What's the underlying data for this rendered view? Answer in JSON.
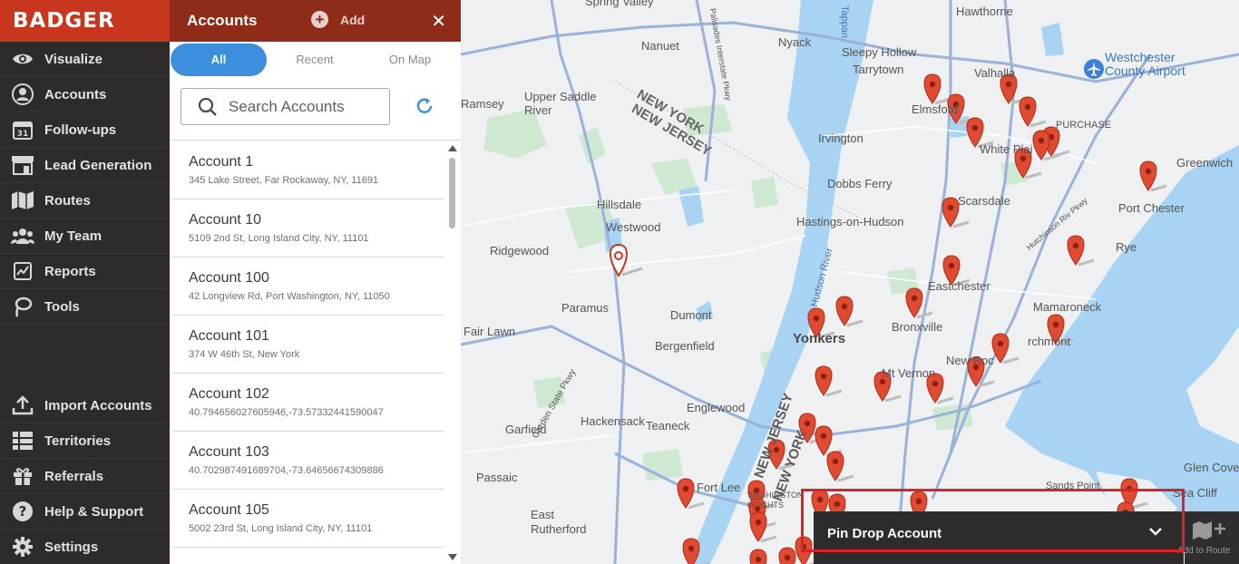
{
  "brand": {
    "logo_text": "BADGER",
    "color": "#c8361d"
  },
  "sidebar": {
    "items": [
      {
        "label": "Visualize",
        "icon": "eye-icon"
      },
      {
        "label": "Accounts",
        "icon": "user-circle-icon"
      },
      {
        "label": "Follow-ups",
        "icon": "calendar-icon",
        "icon_text": "31"
      },
      {
        "label": "Lead Generation",
        "icon": "storefront-icon"
      },
      {
        "label": "Routes",
        "icon": "map-icon"
      },
      {
        "label": "My Team",
        "icon": "team-icon"
      },
      {
        "label": "Reports",
        "icon": "report-icon"
      },
      {
        "label": "Tools",
        "icon": "lasso-icon"
      }
    ],
    "bottom_items": [
      {
        "label": "Import Accounts",
        "icon": "upload-icon"
      },
      {
        "label": "Territories",
        "icon": "territories-icon"
      },
      {
        "label": "Referrals",
        "icon": "gift-icon"
      },
      {
        "label": "Help & Support",
        "icon": "question-icon"
      },
      {
        "label": "Settings",
        "icon": "gear-icon"
      }
    ]
  },
  "panel": {
    "title": "Accounts",
    "add_label": "Add",
    "header_color": "#8e2b19",
    "tabs": [
      {
        "label": "All",
        "active": true
      },
      {
        "label": "Recent",
        "active": false
      },
      {
        "label": "On Map",
        "active": false
      }
    ],
    "search": {
      "placeholder": "Search Accounts",
      "value": ""
    },
    "accounts": [
      {
        "name": "Account 1",
        "address": "345 Lake Street, Far Rockaway, NY, 11691"
      },
      {
        "name": "Account 10",
        "address": "5109 2nd St, Long Island City, NY, 11101"
      },
      {
        "name": "Account 100",
        "address": "42 Longview Rd, Port Washington, NY, 11050"
      },
      {
        "name": "Account 101",
        "address": "374 W 46th St, New York"
      },
      {
        "name": "Account 102",
        "address": "40.794656027605946,-73.57332441590047"
      },
      {
        "name": "Account 103",
        "address": "40.702987491689704,-73.64656674309886"
      },
      {
        "name": "Account 105",
        "address": "5002 23rd St, Long Island City, NY, 11101"
      }
    ]
  },
  "map": {
    "labels": {
      "spring_valley": "Spring Valley",
      "nanuet": "Nanuet",
      "nyack": "Nyack",
      "sleepy_hollow": "Sleepy Hollow",
      "tarrytown": "Tarrytown",
      "hawthorne": "Hawthorne",
      "valhalla": "Valhalla",
      "westchester_airport": "Westchester County Airport",
      "ramsey": "Ramsey",
      "upper_saddle_river": "Upper Saddle River",
      "new_york_state": "NEW YORK",
      "new_jersey_state": "NEW JERSEY",
      "elmsford": "Elmsford",
      "white_plains": "White Plai",
      "purchase": "PURCHASE",
      "greenwich": "Greenwich",
      "irvington": "Irvington",
      "dobbs_ferry": "Dobbs Ferry",
      "scarsdale": "Scarsdale",
      "port_chester": "Port Chester",
      "hillsdale": "Hillsdale",
      "westwood": "Westwood",
      "ridgewood": "Ridgewood",
      "hastings": "Hastings-on-Hudson",
      "rye": "Rye",
      "paramus": "Paramus",
      "dumont": "Dumont",
      "eastchester": "Eastchester",
      "bronxville": "Bronxville",
      "mamaroneck": "Mamaroneck",
      "fair_lawn": "Fair Lawn",
      "bergenfield": "Bergenfield",
      "yonkers": "Yonkers",
      "larchmont": "rchmont",
      "new_rochelle": "New Roc",
      "mt_vernon": "Mt Vernon",
      "garfield": "Garfield",
      "hackensack": "Hackensack",
      "teaneck": "Teaneck",
      "englewood": "Englewood",
      "passaic": "Passaic",
      "fort_lee": "Fort Lee",
      "washington_heights": "WASHINGTON HEIGHTS",
      "rutherford": "East Rutherford",
      "glen_cove": "Glen Cove",
      "sands_point": "Sands Point",
      "sea_cliff": "Sea Cliff",
      "hudson_river": "Hudson River",
      "tappan": "Tappan",
      "new_jersey_vertical": "NEW JERSEY",
      "new_york_vertical": "NEW YORK",
      "hutchinson": "Hutchinson Riv Pkwy",
      "garden_state": "Garden State Pkwy",
      "palisades": "Palisades Interstate Pkwy"
    }
  },
  "pin_drop": {
    "title": "Pin Drop Account",
    "route_label": "Add to Route"
  }
}
